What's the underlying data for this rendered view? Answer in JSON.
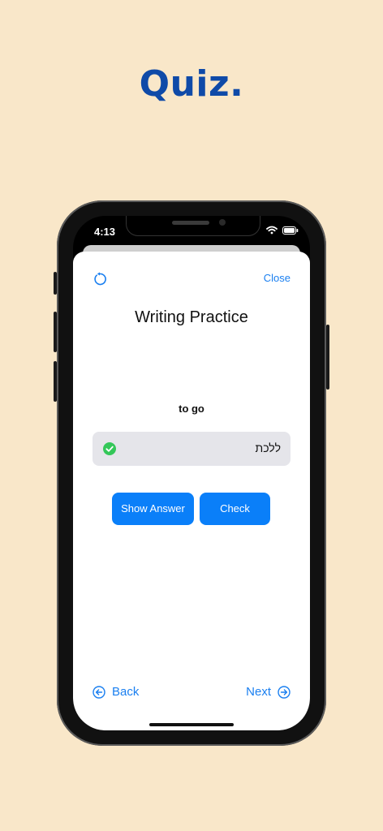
{
  "headline": "Quiz.",
  "status": {
    "time": "4:13"
  },
  "header": {
    "close_label": "Close",
    "refresh_icon": "refresh-icon"
  },
  "title": "Writing Practice",
  "prompt": "to go",
  "answer": {
    "value": "ללכת",
    "status_icon": "check-circle-icon"
  },
  "actions": {
    "show_answer_label": "Show Answer",
    "check_label": "Check"
  },
  "navigation": {
    "back_label": "Back",
    "next_label": "Next"
  },
  "colors": {
    "background": "#f9e7c9",
    "headline": "#0f4aa8",
    "accent": "#0a7ff9",
    "success": "#34c759"
  }
}
